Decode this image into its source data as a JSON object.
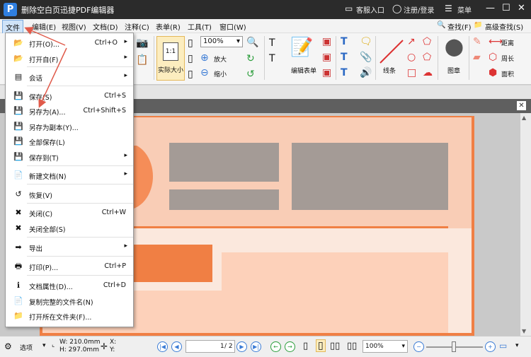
{
  "titlebar": {
    "logo": "P",
    "title": "删除空白页迅捷PDF编辑器",
    "service": "客服入口",
    "login": "注册/登录",
    "menu": "菜单"
  },
  "menubar": {
    "items": [
      "文件",
      "编辑(E)",
      "视图(V)",
      "文档(D)",
      "注释(C)",
      "表单(R)",
      "工具(T)",
      "窗口(W)"
    ],
    "find": "查找(F)",
    "advanced_find": "高级查找(S)"
  },
  "ribbon": {
    "zoom_value": "100%",
    "actual_size": "实际大小",
    "zoom_in": "放大",
    "zoom_out": "缩小",
    "edit_form": "编辑表单",
    "line": "线条",
    "stamp": "图章",
    "distance": "距离",
    "perimeter": "周长",
    "area": "面积"
  },
  "file_menu": [
    {
      "label": "打开(O)...",
      "shortcut": "Ctrl+O",
      "submenu": true,
      "icon": "folder-open-icon"
    },
    {
      "label": "打开自(F)",
      "shortcut": "",
      "submenu": true,
      "icon": "folder-globe-icon"
    },
    {
      "label": "会话",
      "shortcut": "",
      "submenu": true,
      "icon": "session-icon"
    },
    {
      "label": "保存(S)",
      "shortcut": "Ctrl+S",
      "submenu": false,
      "icon": "save-icon"
    },
    {
      "label": "另存为(A)...",
      "shortcut": "Ctrl+Shift+S",
      "submenu": false,
      "icon": "save-as-icon"
    },
    {
      "label": "另存为副本(Y)...",
      "shortcut": "",
      "submenu": false,
      "icon": "save-copy-icon"
    },
    {
      "label": "全部保存(L)",
      "shortcut": "",
      "submenu": false,
      "icon": "save-all-icon"
    },
    {
      "label": "保存到(T)",
      "shortcut": "",
      "submenu": true,
      "icon": "save-to-icon"
    },
    {
      "label": "新建文档(N)",
      "shortcut": "",
      "submenu": true,
      "icon": "new-document-icon"
    },
    {
      "label": "恢复(V)",
      "shortcut": "",
      "submenu": false,
      "icon": "revert-icon"
    },
    {
      "label": "关闭(C)",
      "shortcut": "Ctrl+W",
      "submenu": false,
      "icon": "close-doc-icon"
    },
    {
      "label": "关闭全部(S)",
      "shortcut": "",
      "submenu": false,
      "icon": "close-all-icon"
    },
    {
      "label": "导出",
      "shortcut": "",
      "submenu": true,
      "icon": "export-icon"
    },
    {
      "label": "打印(P)...",
      "shortcut": "Ctrl+P",
      "submenu": false,
      "icon": "print-icon"
    },
    {
      "label": "文档属性(D)...",
      "shortcut": "Ctrl+D",
      "submenu": false,
      "icon": "properties-icon"
    },
    {
      "label": "复制完整的文件名(N)",
      "shortcut": "",
      "submenu": false,
      "icon": "copy-filename-icon"
    },
    {
      "label": "打开所在文件夹(F)...",
      "shortcut": "",
      "submenu": false,
      "icon": "open-folder-icon"
    }
  ],
  "statusbar": {
    "options": "选项",
    "width": "W: 210.0mm",
    "height": "H: 297.0mm",
    "x": "X:",
    "y": "Y:",
    "page": "1",
    "page_total": "/ 2",
    "zoom": "100%"
  },
  "colors": {
    "accent_orange": "#f07f44",
    "annotation_arrow": "#e05a4a",
    "title_bg": "#2b2b2b"
  }
}
